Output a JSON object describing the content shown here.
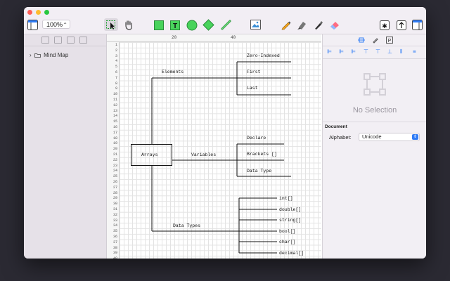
{
  "window": {
    "zoom": "100%"
  },
  "toolbar": {
    "tools": [
      "sidebar-toggle-icon",
      "select-tool-icon",
      "hand-tool-icon",
      "rectangle-tool-icon",
      "text-tool-icon",
      "circle-tool-icon",
      "diamond-tool-icon",
      "line-tool-icon",
      "image-tool-icon",
      "pencil-tool-icon",
      "highlighter-tool-icon",
      "pen-tool-icon",
      "eraser-tool-icon",
      "export-icon",
      "share-icon",
      "inspector-toggle-icon"
    ],
    "colors": {
      "accent": "#2f7cf6",
      "shape_fill": "#49d35c",
      "traffic_red": "#fe5f57",
      "traffic_yellow": "#febc2e",
      "traffic_green": "#28c840"
    }
  },
  "sidebar": {
    "items": [
      {
        "label": "Mind Map"
      }
    ]
  },
  "canvas": {
    "ruler_marks": [
      "20",
      "40"
    ],
    "line_numbers": [
      "1",
      "2",
      "3",
      "4",
      "5",
      "6",
      "7",
      "8",
      "9",
      "10",
      "11",
      "12",
      "13",
      "14",
      "15",
      "16",
      "17",
      "18",
      "19",
      "20",
      "21",
      "22",
      "23",
      "24",
      "25",
      "26",
      "27",
      "28",
      "29",
      "30",
      "31",
      "32",
      "33",
      "34",
      "35",
      "36",
      "37",
      "38",
      "39",
      "40"
    ],
    "diagram": {
      "root": "Arrays",
      "branches": {
        "elements": {
          "label": "Elements",
          "children": [
            "Zero-Indexed",
            "First",
            "Last"
          ]
        },
        "variables": {
          "label": "Variables",
          "children": [
            "Declare",
            "Brackets []",
            "Data Type"
          ]
        },
        "data_types": {
          "label": "Data Types",
          "children": [
            "int[]",
            "double[]",
            "string[]",
            "bool[]",
            "char[]",
            "decimal[]"
          ]
        }
      }
    }
  },
  "inspector": {
    "no_selection": "No Selection",
    "document_title": "Document",
    "alphabet_label": "Alphabet:",
    "alphabet_value": "Unicode"
  }
}
